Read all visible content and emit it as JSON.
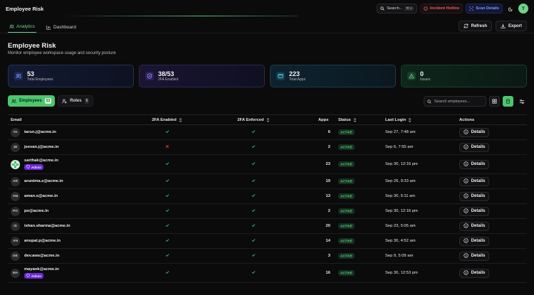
{
  "app": {
    "title": "Employee Risk"
  },
  "topbar": {
    "search_label": "Search...",
    "search_shortcut": "⌘ K",
    "incident_label": "Incident Hotline",
    "scan_label": "Scan Details",
    "user_initial": "T"
  },
  "tabs": [
    {
      "label": "Analytics",
      "active": true
    },
    {
      "label": "Dashboard",
      "active": false
    }
  ],
  "toolbar": {
    "refresh_label": "Refresh",
    "export_label": "Export"
  },
  "page": {
    "title": "Employee Risk",
    "subtitle": "Monitor employee workspace usage and security posture"
  },
  "cards": [
    {
      "value": "53",
      "label": "Total Employees",
      "icon": "users-icon",
      "color": "#6b8cff"
    },
    {
      "value": "38/53",
      "label": "2FA Enabled",
      "icon": "shield-check-icon",
      "color": "#9b7bff"
    },
    {
      "value": "223",
      "label": "Total Apps",
      "icon": "app-window-icon",
      "color": "#4fc3e6"
    },
    {
      "value": "0",
      "label": "Issues",
      "icon": "warning-icon",
      "color": "#5fd183"
    }
  ],
  "segments": {
    "employees_label": "Employees",
    "employees_count": "53",
    "roles_label": "Roles",
    "roles_count": "6"
  },
  "search": {
    "placeholder": "Search employees..."
  },
  "table": {
    "headers": {
      "email": "Email",
      "twofa_enabled": "2FA Enabled",
      "twofa_enforced": "2FA Enforced",
      "apps": "Apps",
      "status": "Status",
      "last_login": "Last Login",
      "actions": "Actions"
    },
    "details_label": "Details",
    "admin_label": "Admin",
    "rows": [
      {
        "initials": "TA",
        "email": "tarun.j@acme.in",
        "twofa": true,
        "enforced": true,
        "apps": "6",
        "status": "ACTIVE",
        "last_login": "Sep 27, 7:48 am",
        "admin": false
      },
      {
        "initials": "JE",
        "email": "jeevan.j@acme.in",
        "twofa": false,
        "enforced": true,
        "apps": "2",
        "status": "ACTIVE",
        "last_login": "Sep 6, 7:55 am",
        "admin": false
      },
      {
        "initials": "",
        "email": "sarthak@acme.in",
        "twofa": true,
        "enforced": true,
        "apps": "23",
        "status": "ACTIVE",
        "last_login": "Sep 30, 12:16 pm",
        "admin": true
      },
      {
        "initials": "AR",
        "email": "arunima.s@acme.in",
        "twofa": true,
        "enforced": true,
        "apps": "19",
        "status": "ACTIVE",
        "last_login": "Sep 26, 9:33 am",
        "admin": false
      },
      {
        "initials": "AM",
        "email": "aman.s@acme.in",
        "twofa": true,
        "enforced": true,
        "apps": "13",
        "status": "ACTIVE",
        "last_login": "Sep 30, 5:11 am",
        "admin": false
      },
      {
        "initials": "PO",
        "email": "po@acme.in",
        "twofa": true,
        "enforced": true,
        "apps": "2",
        "status": "ACTIVE",
        "last_login": "Sep 30, 12:16 pm",
        "admin": false
      },
      {
        "initials": "IS",
        "email": "ishan.sharma@acme.in",
        "twofa": true,
        "enforced": true,
        "apps": "20",
        "status": "ACTIVE",
        "last_login": "Sep 23, 5:05 am",
        "admin": false
      },
      {
        "initials": "AN",
        "email": "anupal.p@acme.in",
        "twofa": true,
        "enforced": true,
        "apps": "14",
        "status": "ACTIVE",
        "last_login": "Sep 30, 4:52 am",
        "admin": false
      },
      {
        "initials": "DE",
        "email": "dev.aws@acme.in",
        "twofa": true,
        "enforced": true,
        "apps": "3",
        "status": "ACTIVE",
        "last_login": "Sep 9, 5:09 am",
        "admin": false
      },
      {
        "initials": "MA",
        "email": "mayank@acme.in",
        "twofa": true,
        "enforced": true,
        "apps": "16",
        "status": "ACTIVE",
        "last_login": "Sep 30, 12:53 pm",
        "admin": true
      }
    ]
  }
}
